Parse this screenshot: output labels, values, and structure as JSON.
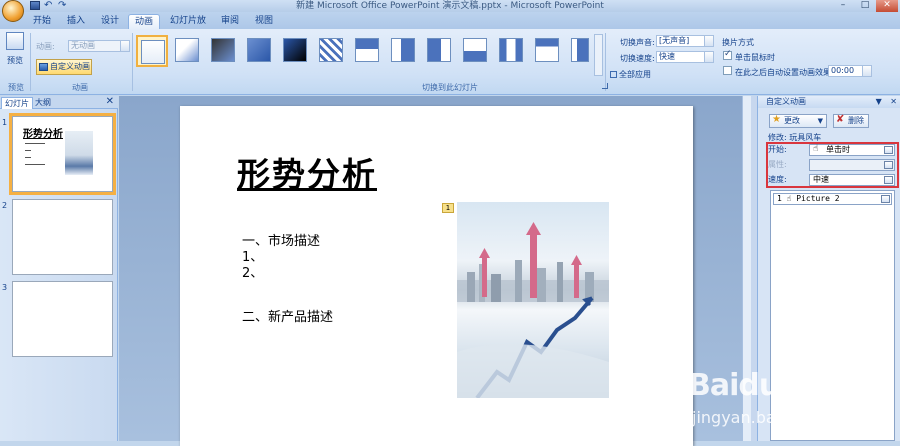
{
  "window": {
    "title": "新建 Microsoft Office PowerPoint 演示文稿.pptx - Microsoft PowerPoint",
    "controls": [
      "–",
      "□",
      "✕"
    ]
  },
  "ribbon_tabs": [
    {
      "label": "开始"
    },
    {
      "label": "插入"
    },
    {
      "label": "设计"
    },
    {
      "label": "动画"
    },
    {
      "label": "幻灯片放映"
    },
    {
      "label": "审阅"
    },
    {
      "label": "视图"
    }
  ],
  "active_tab": "动画",
  "ribbon": {
    "preview": {
      "label": "预览",
      "group": "预览"
    },
    "animation_group": {
      "label": "动画",
      "animation_label": "动画:",
      "animation_value": "无动画",
      "custom_button": "自定义动画"
    },
    "transition_group": {
      "label": "切换到此幻灯片"
    },
    "transition_sound_label": "切换声音:",
    "transition_sound_value": "[无声音]",
    "transition_speed_label": "切换速度:",
    "transition_speed_value": "快速",
    "apply_all": "全部应用",
    "advance": {
      "title": "换片方式",
      "on_click": "单击鼠标时",
      "on_click_checked": true,
      "after_auto": "在此之后自动设置动画效果:",
      "after_auto_checked": false,
      "time_value": "00:00"
    }
  },
  "left_panel": {
    "tabs": [
      "幻灯片",
      "大纲"
    ],
    "close": "✕",
    "slides": [
      {
        "num": "1",
        "title": "形势分析",
        "selected": true
      },
      {
        "num": "2",
        "selected": false
      },
      {
        "num": "3",
        "selected": false
      }
    ]
  },
  "slide": {
    "title": "形势分析",
    "lines": [
      "一、市场描述",
      "1、",
      "2、",
      "二、新产品描述"
    ],
    "anim_marker": "1"
  },
  "task_pane": {
    "title": "自定义动画",
    "controls": [
      "▼",
      "✕"
    ],
    "change_button": "更改",
    "delete_button": "删除",
    "modify_label": "修改: 玩具风车",
    "start_label": "开始:",
    "start_value": "单击时",
    "property_label": "属性:",
    "property_value": "",
    "speed_label": "速度:",
    "speed_value": "中速",
    "list_item": "1 ☝  Picture 2"
  },
  "watermark": {
    "brand": "Baidu经验",
    "sub": "jingyan.baidu.com"
  },
  "colors": {
    "ribbon_text": "#15428b",
    "highlight": "#d9363e",
    "selected_outline": "#f5b043"
  }
}
